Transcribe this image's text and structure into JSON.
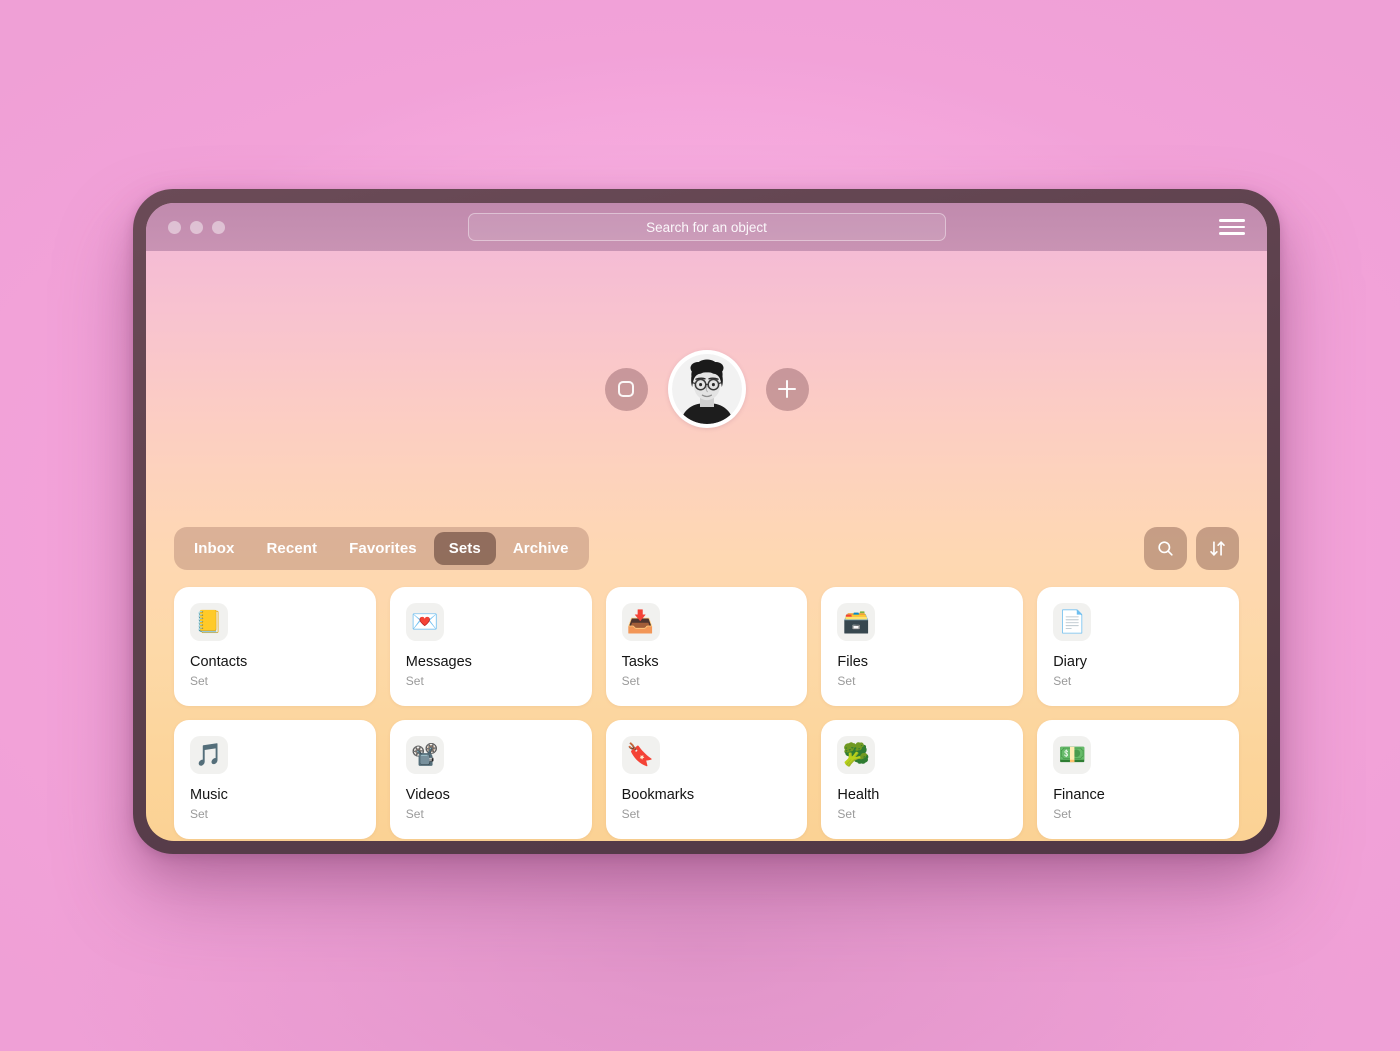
{
  "window": {
    "traffic_lights": [
      "close",
      "minimize",
      "maximize"
    ],
    "search": {
      "placeholder": "Search for an object",
      "value": ""
    },
    "menu_label": "Menu"
  },
  "hero": {
    "left_button_icon": "rounded-square-icon",
    "avatar_alt": "User profile photo",
    "right_button_icon": "plus-icon"
  },
  "toolbar": {
    "tabs": [
      {
        "label": "Inbox",
        "active": false
      },
      {
        "label": "Recent",
        "active": false
      },
      {
        "label": "Favorites",
        "active": false
      },
      {
        "label": "Sets",
        "active": true
      },
      {
        "label": "Archive",
        "active": false
      }
    ],
    "actions": [
      {
        "name": "search-icon",
        "label": "Search"
      },
      {
        "name": "sort-icon",
        "label": "Sort"
      }
    ]
  },
  "grid": {
    "cards": [
      {
        "title": "Contacts",
        "subtitle": "Set",
        "emoji": "📒",
        "icon_name": "address-book-icon"
      },
      {
        "title": "Messages",
        "subtitle": "Set",
        "emoji": "💌",
        "icon_name": "love-letter-icon"
      },
      {
        "title": "Tasks",
        "subtitle": "Set",
        "emoji": "📥",
        "icon_name": "inbox-tray-icon"
      },
      {
        "title": "Files",
        "subtitle": "Set",
        "emoji": "🗃️",
        "icon_name": "card-file-box-icon"
      },
      {
        "title": "Diary",
        "subtitle": "Set",
        "emoji": "📄",
        "icon_name": "page-facing-up-icon"
      },
      {
        "title": "Music",
        "subtitle": "Set",
        "emoji": "🎵",
        "icon_name": "musical-note-icon"
      },
      {
        "title": "Videos",
        "subtitle": "Set",
        "emoji": "📽️",
        "icon_name": "film-projector-icon"
      },
      {
        "title": "Bookmarks",
        "subtitle": "Set",
        "emoji": "🔖",
        "icon_name": "bookmark-icon"
      },
      {
        "title": "Health",
        "subtitle": "Set",
        "emoji": "🥦",
        "icon_name": "broccoli-icon"
      },
      {
        "title": "Finance",
        "subtitle": "Set",
        "emoji": "💵",
        "icon_name": "banknote-icon"
      }
    ]
  },
  "colors": {
    "backdrop_pink": "#f2a3da",
    "window_bezel": "#5d414d",
    "titlebar": "#c08cae",
    "content_top": "#f2b8d6",
    "content_bottom": "#fbd294",
    "tab_bar": "#c8a592",
    "tab_active": "#8a6f60",
    "card_bg": "#ffffff",
    "card_title": "#141414",
    "card_subtitle": "#9a9a9a"
  }
}
